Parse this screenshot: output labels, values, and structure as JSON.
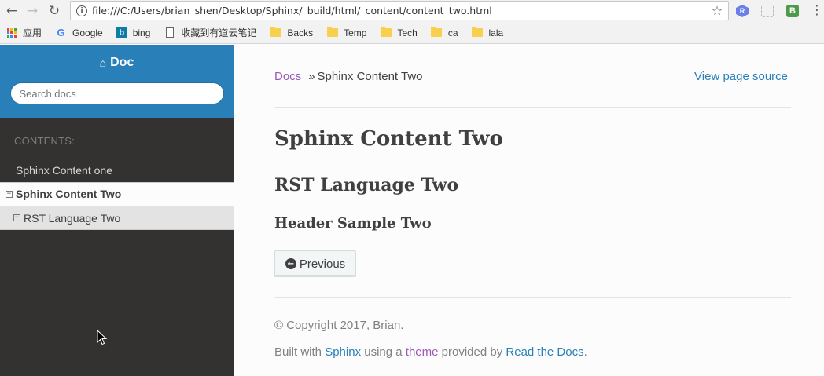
{
  "browser": {
    "url": "file:///C:/Users/brian_shen/Desktop/Sphinx/_build/html/_content/content_two.html",
    "bookmarks": [
      {
        "label": "应用",
        "icon": "apps-icon"
      },
      {
        "label": "Google",
        "icon": "google-icon"
      },
      {
        "label": "bing",
        "icon": "bing-icon"
      },
      {
        "label": "收藏到有道云笔记",
        "icon": "page-icon"
      },
      {
        "label": "Backs",
        "icon": "folder-icon"
      },
      {
        "label": "Temp",
        "icon": "folder-icon"
      },
      {
        "label": "Tech",
        "icon": "folder-icon"
      },
      {
        "label": "ca",
        "icon": "folder-icon"
      },
      {
        "label": "lala",
        "icon": "folder-icon"
      }
    ],
    "extensions": {
      "r_label": "R",
      "b_label": "B"
    }
  },
  "sidebar": {
    "project": "Doc",
    "search_placeholder": "Search docs",
    "caption": "CONTENTS:",
    "toc": {
      "item1": "Sphinx Content one",
      "current": "Sphinx Content Two",
      "sub": "RST Language Two"
    },
    "bg_color": "#343131",
    "header_color": "#2980b9"
  },
  "main": {
    "breadcrumb": {
      "home": "Docs",
      "separator": "»",
      "current": "Sphinx Content Two"
    },
    "view_source": "View page source",
    "h1": "Sphinx Content Two",
    "h2": "RST Language Two",
    "h3": "Header Sample Two",
    "previous_button": "Previous",
    "footer": {
      "copyright": "© Copyright 2017, Brian.",
      "built_prefix": "Built with ",
      "sphinx": "Sphinx",
      "using": " using a ",
      "theme": "theme",
      "provided": " provided by ",
      "rtd": "Read the Docs",
      "period": "."
    }
  }
}
